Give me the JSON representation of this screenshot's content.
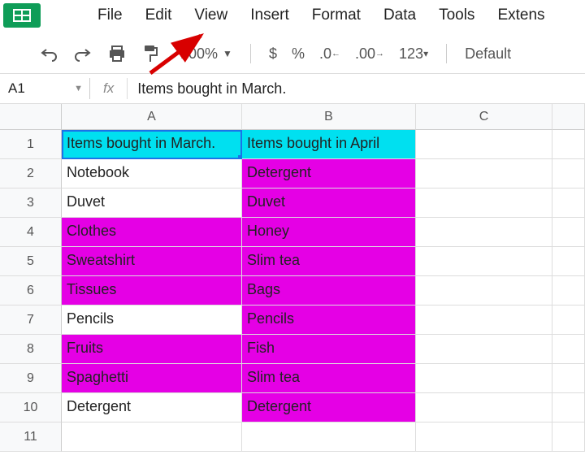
{
  "menu": [
    "File",
    "Edit",
    "View",
    "Insert",
    "Format",
    "Data",
    "Tools",
    "Extens"
  ],
  "toolbar": {
    "zoom": "100%",
    "currency": "$",
    "percent": "%",
    "dec_decrease": ".0",
    "dec_increase": ".00",
    "numfmt": "123",
    "font": "Default"
  },
  "formula": {
    "cell_ref": "A1",
    "fx_label": "fx",
    "content": "Items bought in March."
  },
  "columns": [
    "A",
    "B",
    "C"
  ],
  "row_numbers": [
    1,
    2,
    3,
    4,
    5,
    6,
    7,
    8,
    9,
    10,
    11
  ],
  "cells": {
    "A": [
      "Items bought in March.",
      "Notebook",
      "Duvet",
      "Clothes",
      "Sweatshirt",
      "Tissues",
      "Pencils",
      "Fruits",
      "Spaghetti",
      "Detergent",
      ""
    ],
    "B": [
      "Items bought in April",
      "Detergent",
      "Duvet",
      "Honey",
      "Slim tea",
      "Bags",
      "Pencils",
      "Fish",
      "Slim tea",
      "Detergent",
      ""
    ]
  },
  "cell_colors": {
    "A": [
      "cyan",
      "white",
      "white",
      "magenta",
      "magenta",
      "magenta",
      "white",
      "magenta",
      "magenta",
      "white",
      "white"
    ],
    "B": [
      "cyan",
      "magenta",
      "magenta",
      "magenta",
      "magenta",
      "magenta",
      "magenta",
      "magenta",
      "magenta",
      "magenta",
      "white"
    ]
  },
  "selected_cell": "A1"
}
